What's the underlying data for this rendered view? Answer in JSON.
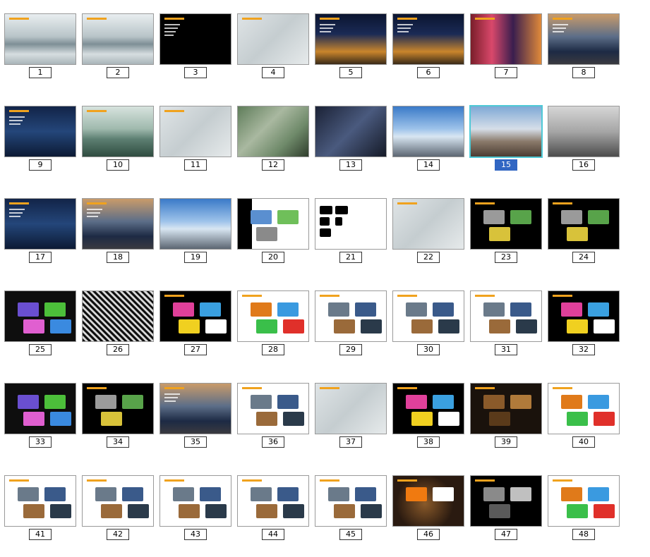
{
  "selected_slide": "15",
  "slides": [
    {
      "num": "1",
      "theme": "mist"
    },
    {
      "num": "2",
      "theme": "mist"
    },
    {
      "num": "3",
      "theme": "black-text"
    },
    {
      "num": "4",
      "theme": "pale-plan"
    },
    {
      "num": "5",
      "theme": "night-city"
    },
    {
      "num": "6",
      "theme": "night-city"
    },
    {
      "num": "7",
      "theme": "neon-street"
    },
    {
      "num": "8",
      "theme": "dusk-city"
    },
    {
      "num": "9",
      "theme": "night-blue"
    },
    {
      "num": "10",
      "theme": "lake"
    },
    {
      "num": "11",
      "theme": "pale-plan"
    },
    {
      "num": "12",
      "theme": "aerial"
    },
    {
      "num": "13",
      "theme": "aerial-night"
    },
    {
      "num": "14",
      "theme": "sky-buildings"
    },
    {
      "num": "15",
      "theme": "mall"
    },
    {
      "num": "16",
      "theme": "mall-grey"
    },
    {
      "num": "17",
      "theme": "night-blue"
    },
    {
      "num": "18",
      "theme": "dusk-city"
    },
    {
      "num": "19",
      "theme": "sky-buildings"
    },
    {
      "num": "20",
      "theme": "plan-white"
    },
    {
      "num": "21",
      "theme": "white-black"
    },
    {
      "num": "22",
      "theme": "pale-plan"
    },
    {
      "num": "23",
      "theme": "black-map"
    },
    {
      "num": "24",
      "theme": "black-map"
    },
    {
      "num": "25",
      "theme": "colour-map"
    },
    {
      "num": "26",
      "theme": "bw-maps"
    },
    {
      "num": "27",
      "theme": "black-diagram"
    },
    {
      "num": "28",
      "theme": "white-diagram"
    },
    {
      "num": "29",
      "theme": "white-photos"
    },
    {
      "num": "30",
      "theme": "white-photos"
    },
    {
      "num": "31",
      "theme": "white-photos"
    },
    {
      "num": "32",
      "theme": "black-diagram"
    },
    {
      "num": "33",
      "theme": "colour-map"
    },
    {
      "num": "34",
      "theme": "black-map"
    },
    {
      "num": "35",
      "theme": "dusk-city"
    },
    {
      "num": "36",
      "theme": "white-photos"
    },
    {
      "num": "37",
      "theme": "pale-plan"
    },
    {
      "num": "38",
      "theme": "black-diagram"
    },
    {
      "num": "39",
      "theme": "brown-photos"
    },
    {
      "num": "40",
      "theme": "white-diagram"
    },
    {
      "num": "41",
      "theme": "white-photos"
    },
    {
      "num": "42",
      "theme": "white-photos"
    },
    {
      "num": "43",
      "theme": "white-photos"
    },
    {
      "num": "44",
      "theme": "white-photos"
    },
    {
      "num": "45",
      "theme": "white-photos"
    },
    {
      "num": "46",
      "theme": "brown-diagram"
    },
    {
      "num": "47",
      "theme": "black-photos"
    },
    {
      "num": "48",
      "theme": "white-diagram"
    }
  ],
  "colors": {
    "selection_border": "#4fc9d6",
    "selected_label_bg": "#3166c3",
    "accent_title": "#f0a21e"
  }
}
